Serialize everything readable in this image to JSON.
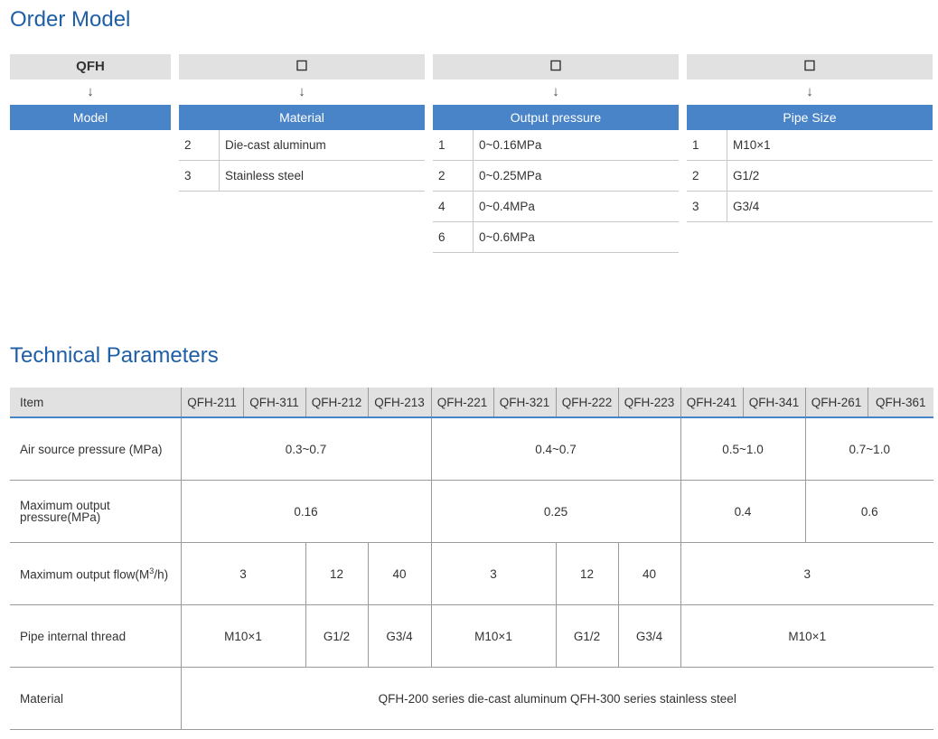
{
  "order_model": {
    "title": "Order Model",
    "columns": [
      {
        "code": "QFH",
        "arrow": "↓",
        "label": "Model",
        "options": []
      },
      {
        "code": "☐",
        "arrow": "↓",
        "label": "Material",
        "options": [
          {
            "num": "2",
            "text": "Die-cast aluminum"
          },
          {
            "num": "3",
            "text": "Stainless steel"
          }
        ]
      },
      {
        "code": "☐",
        "arrow": "↓",
        "label": "Output pressure",
        "options": [
          {
            "num": "1",
            "text": "0~0.16MPa"
          },
          {
            "num": "2",
            "text": "0~0.25MPa"
          },
          {
            "num": "4",
            "text": "0~0.4MPa"
          },
          {
            "num": "6",
            "text": "0~0.6MPa"
          }
        ]
      },
      {
        "code": "☐",
        "arrow": "↓",
        "label": "Pipe Size",
        "options": [
          {
            "num": "1",
            "text": "M10×1"
          },
          {
            "num": "2",
            "text": "G1/2"
          },
          {
            "num": "3",
            "text": "G3/4"
          }
        ]
      }
    ]
  },
  "technical": {
    "title": "Technical Parameters",
    "header": [
      "Item",
      "QFH-211",
      "QFH-311",
      "QFH-212",
      "QFH-213",
      "QFH-221",
      "QFH-321",
      "QFH-222",
      "QFH-223",
      "QFH-241",
      "QFH-341",
      "QFH-261",
      "QFH-361"
    ],
    "rows": {
      "air_source": {
        "label": "Air source pressure (MPa)",
        "values": [
          "0.3~0.7",
          "0.4~0.7",
          "0.5~1.0",
          "0.7~1.0"
        ]
      },
      "max_output_pressure": {
        "label_line1": "Maximum output",
        "label_line2": "pressure(MPa)",
        "values": [
          "0.16",
          "0.25",
          "0.4",
          "0.6"
        ]
      },
      "max_output_flow": {
        "label": "Maximum output flow(M",
        "label_sup": "3",
        "label_end": "/h)",
        "values": [
          "3",
          "12",
          "40",
          "3",
          "12",
          "40",
          "3"
        ]
      },
      "pipe_thread": {
        "label": "Pipe internal thread",
        "values": [
          "M10×1",
          "G1/2",
          "G3/4",
          "M10×1",
          "G1/2",
          "G3/4",
          "M10×1"
        ]
      },
      "material": {
        "label": "Material",
        "value": "QFH-200 series die-cast aluminum QFH-300 series stainless steel"
      }
    }
  },
  "colors": {
    "heading": "#1f5fa6",
    "band": "#4a84c8",
    "header_bg": "#e1e1e1"
  }
}
